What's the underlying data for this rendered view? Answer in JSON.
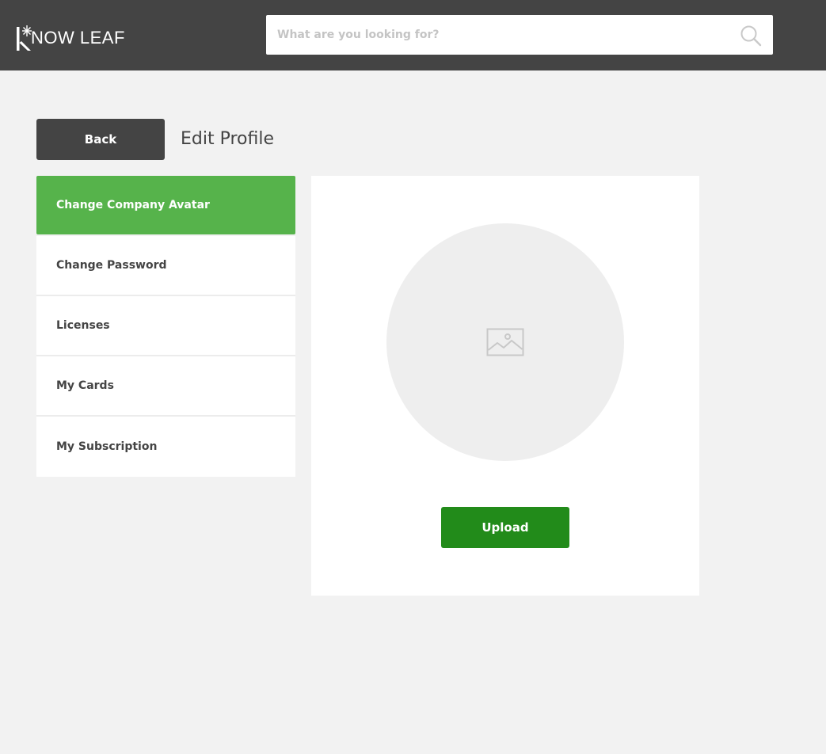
{
  "header": {
    "logo_text": "NOW LEAF",
    "logo_letter": "K",
    "search_placeholder": "What are you looking for?",
    "search_value": ""
  },
  "page": {
    "back_label": "Back",
    "title": "Edit Profile"
  },
  "sidebar": {
    "items": [
      {
        "label": "Change Company Avatar",
        "active": true
      },
      {
        "label": "Change Password",
        "active": false
      },
      {
        "label": "Licenses",
        "active": false
      },
      {
        "label": "My Cards",
        "active": false
      },
      {
        "label": "My Subscription",
        "active": false
      }
    ]
  },
  "avatar_panel": {
    "upload_label": "Upload",
    "placeholder_icon": "image-icon"
  },
  "colors": {
    "topbar": "#444444",
    "active_menu": "#56b34b",
    "upload_button": "#228b1a",
    "background": "#f2f2f2"
  }
}
